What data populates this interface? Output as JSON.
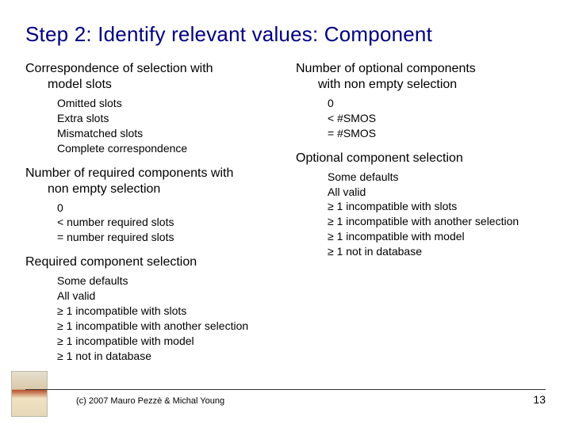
{
  "title": "Step 2: Identify relevant values: Component",
  "left": {
    "s1": {
      "head1": "Correspondence of selection with",
      "head2": "model slots",
      "i1": "Omitted slots",
      "i2": "Extra slots",
      "i3": "Mismatched slots",
      "i4": "Complete correspondence"
    },
    "s2": {
      "head1": "Number of required components with",
      "head2": "non empty selection",
      "i1": "0",
      "i2": "< number required slots",
      "i3": "= number required slots"
    },
    "s3": {
      "head": "Required component selection",
      "i1": "Some defaults",
      "i2": "All valid",
      "i3": "≥ 1 incompatible with slots",
      "i4": "≥ 1 incompatible with another selection",
      "i5": "≥ 1 incompatible with model",
      "i6": "≥ 1 not in database"
    }
  },
  "right": {
    "s1": {
      "head1": "Number of optional components",
      "head2": "with non empty selection",
      "i1": "0",
      "i2": "< #SMOS",
      "i3": "= #SMOS"
    },
    "s2": {
      "head": "Optional component selection",
      "i1": "Some defaults",
      "i2": "All valid",
      "i3": "≥ 1 incompatible with slots",
      "i4": "≥ 1 incompatible with another",
      "i4b": "selection",
      "i5": "≥ 1 incompatible with model",
      "i6": "≥ 1 not in database"
    }
  },
  "footer": {
    "copyright": "(c) 2007 Mauro Pezzè & Michal Young",
    "page": "13"
  }
}
